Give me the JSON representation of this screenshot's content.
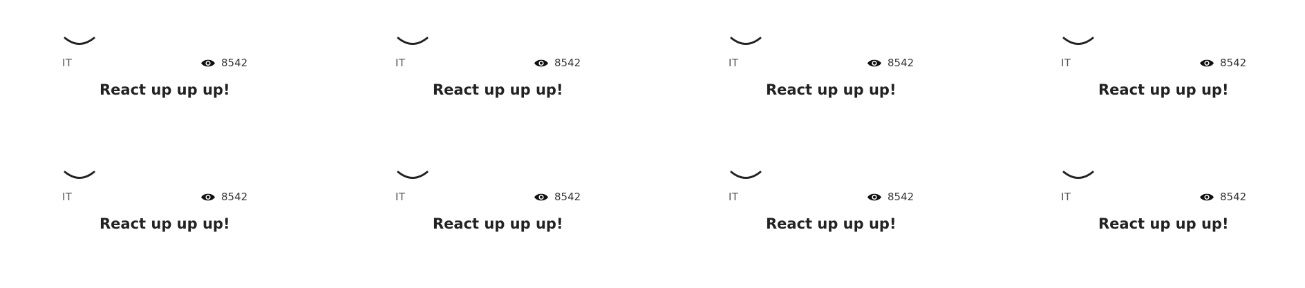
{
  "cards": [
    {
      "category": "IT",
      "views": "8542",
      "title": "React up up up!",
      "icon": "smile-icon"
    },
    {
      "category": "IT",
      "views": "8542",
      "title": "React up up up!",
      "icon": "smile-icon"
    },
    {
      "category": "IT",
      "views": "8542",
      "title": "React up up up!",
      "icon": "smile-icon"
    },
    {
      "category": "IT",
      "views": "8542",
      "title": "React up up up!",
      "icon": "smile-icon"
    },
    {
      "category": "IT",
      "views": "8542",
      "title": "React up up up!",
      "icon": "smile-icon"
    },
    {
      "category": "IT",
      "views": "8542",
      "title": "React up up up!",
      "icon": "smile-icon"
    },
    {
      "category": "IT",
      "views": "8542",
      "title": "React up up up!",
      "icon": "smile-icon"
    },
    {
      "category": "IT",
      "views": "8542",
      "title": "React up up up!",
      "icon": "smile-icon"
    }
  ],
  "view_icon": "eye-icon",
  "colors": {
    "text": "#222222",
    "muted": "#555555",
    "background": "#ffffff"
  }
}
